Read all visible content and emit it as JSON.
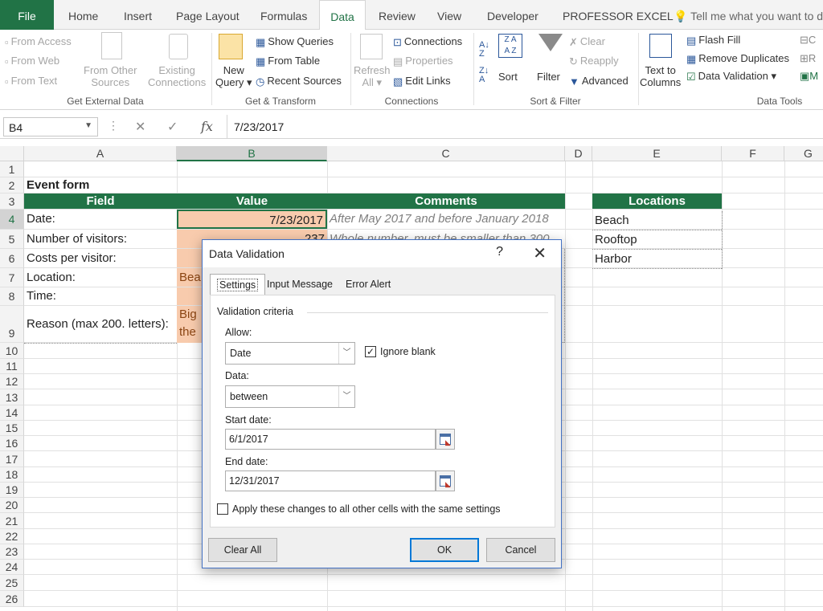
{
  "ribbon_tabs": [
    "File",
    "Home",
    "Insert",
    "Page Layout",
    "Formulas",
    "Data",
    "Review",
    "View",
    "Developer",
    "PROFESSOR EXCEL"
  ],
  "tell_me": "Tell me what you want to do",
  "ribbon": {
    "from_access": "From Access",
    "from_web": "From Web",
    "from_text": "From Text",
    "from_other_1": "From Other",
    "from_other_2": "Sources",
    "existing_1": "Existing",
    "existing_2": "Connections",
    "group_external": "Get External Data",
    "new_query_1": "New",
    "new_query_2": "Query",
    "show_queries": "Show Queries",
    "from_table": "From Table",
    "recent_sources": "Recent Sources",
    "group_transform": "Get & Transform",
    "refresh_1": "Refresh",
    "refresh_2": "All",
    "connections": "Connections",
    "properties": "Properties",
    "edit_links": "Edit Links",
    "group_connections": "Connections",
    "sort": "Sort",
    "filter": "Filter",
    "clear": "Clear",
    "reapply": "Reapply",
    "advanced": "Advanced",
    "group_sort": "Sort & Filter",
    "text_to_1": "Text to",
    "text_to_2": "Columns",
    "flash_fill": "Flash Fill",
    "remove_dup": "Remove Duplicates",
    "data_validation": "Data Validation",
    "group_tools": "Data Tools"
  },
  "formula_bar": {
    "name_box": "B4",
    "fx": "fx",
    "value": "7/23/2017"
  },
  "columns": [
    "A",
    "B",
    "C",
    "D",
    "E",
    "F",
    "G"
  ],
  "rows": [
    "1",
    "2",
    "3",
    "4",
    "5",
    "6",
    "7",
    "8",
    "9",
    "10",
    "11",
    "12",
    "13",
    "14",
    "15",
    "16",
    "17",
    "18",
    "19",
    "20",
    "21",
    "22",
    "23",
    "24",
    "25",
    "26"
  ],
  "cells": {
    "a2": "Event form",
    "a3": "Field",
    "b3": "Value",
    "c3": "Comments",
    "a4": "Date:",
    "b4": "7/23/2017",
    "c4": "After May 2017 and before January 2018",
    "a5": "Number of visitors:",
    "b5": "237",
    "c5": "Whole number, must be smaller than 300",
    "a6": "Costs per visitor:",
    "a7": "Location:",
    "b7": "Bea",
    "a8": "Time:",
    "a9": "Reason (max 200. letters):",
    "b9a": "Big",
    "b9b": "the",
    "e3": "Locations",
    "e4": "Beach",
    "e5": "Rooftop",
    "e6": "Harbor"
  },
  "dialog": {
    "title": "Data Validation",
    "help": "?",
    "close": "✕",
    "tabs": [
      "Settings",
      "Input Message",
      "Error Alert"
    ],
    "criteria": "Validation criteria",
    "allow_label": "Allow:",
    "allow_value": "Date",
    "ignore_blank": "Ignore blank",
    "ignore_checked": "✓",
    "data_label": "Data:",
    "data_value": "between",
    "start_label": "Start date:",
    "start_value": "6/1/2017",
    "end_label": "End date:",
    "end_value": "12/31/2017",
    "apply_all": "Apply these changes to all other cells with the same settings",
    "clear_all": "Clear All",
    "ok": "OK",
    "cancel": "Cancel"
  },
  "colors": {
    "excel_green": "#217346",
    "orange_fill": "#f8cbad",
    "accent_blue": "#0078d7"
  }
}
